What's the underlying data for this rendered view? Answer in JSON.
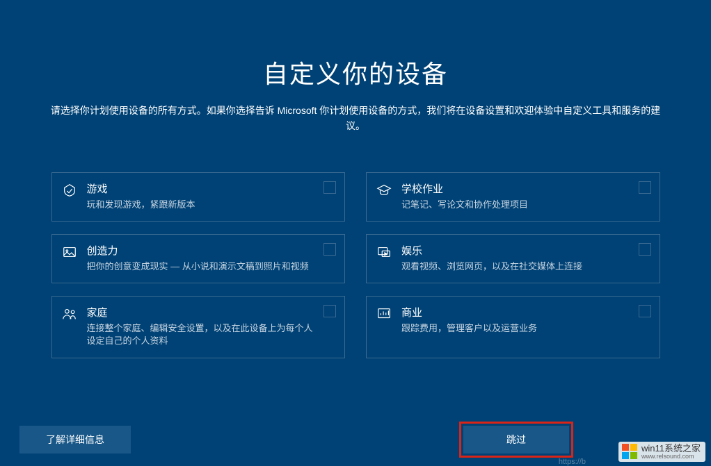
{
  "header": {
    "title": "自定义你的设备",
    "subtitle": "请选择你计划使用设备的所有方式。如果你选择告诉 Microsoft 你计划使用设备的方式，我们将在设备设置和欢迎体验中自定义工具和服务的建议。"
  },
  "options": [
    {
      "icon": "game-icon",
      "title": "游戏",
      "desc": "玩和发现游戏，紧跟新版本"
    },
    {
      "icon": "school-icon",
      "title": "学校作业",
      "desc": "记笔记、写论文和协作处理项目"
    },
    {
      "icon": "creativity-icon",
      "title": "创造力",
      "desc": "把你的创意变成现实 — 从小说和演示文稿到照片和视频"
    },
    {
      "icon": "entertainment-icon",
      "title": "娱乐",
      "desc": "观看视频、浏览网页，以及在社交媒体上连接"
    },
    {
      "icon": "family-icon",
      "title": "家庭",
      "desc": "连接整个家庭、编辑安全设置，以及在此设备上为每个人设定自己的个人资料"
    },
    {
      "icon": "business-icon",
      "title": "商业",
      "desc": "跟踪费用，管理客户以及运营业务"
    }
  ],
  "footer": {
    "learn_more": "了解详细信息",
    "skip": "跳过"
  },
  "watermark": {
    "brand": "win11系统之家",
    "url_display": "www.relsound.com",
    "faint_url": "https://b"
  }
}
